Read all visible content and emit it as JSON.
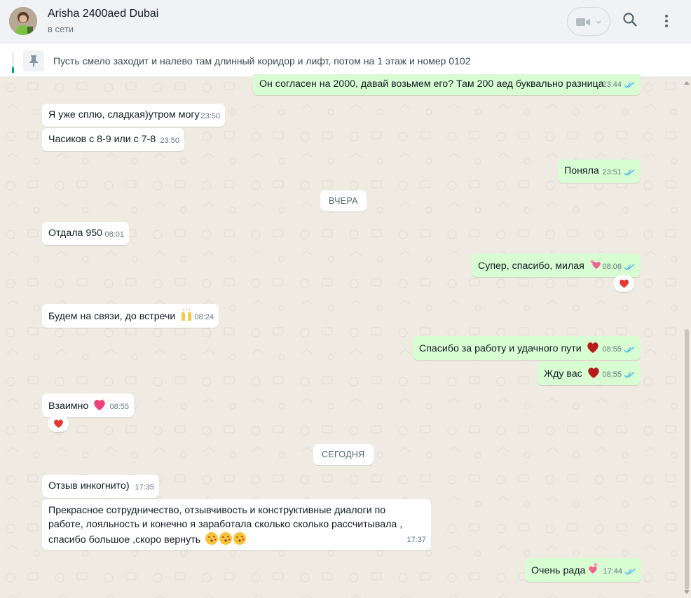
{
  "header": {
    "name": "Arisha 2400aed Dubai",
    "status": "в сети"
  },
  "pinned": {
    "text": "Пусть смело заходит и налево там длинный коридор и лифт, потом на 1 этаж и номер 0102"
  },
  "messages": [
    {
      "dir": "out",
      "text": "Он согласен на 2000, давай возьмем его? Там 200 аед буквально разница",
      "time": "23:44",
      "read": true
    },
    {
      "dir": "in",
      "text": "Я уже сплю, сладкая)утром могу",
      "time": "23:50"
    },
    {
      "dir": "in",
      "text": "Часиков с 8-9 или с 7-8",
      "time": "23:50"
    },
    {
      "dir": "out",
      "text": "Поняла",
      "time": "23:51",
      "read": true
    },
    {
      "dir": "divider",
      "text": "ВЧЕРА"
    },
    {
      "dir": "in",
      "text": "Отдала 950",
      "time": "08:01"
    },
    {
      "dir": "out",
      "text": "Супер, спасибо, милая",
      "emoji": "two-hearts",
      "time": "08:06",
      "read": true,
      "reaction": "heart"
    },
    {
      "dir": "in",
      "text": "Будем на связи, до встречи",
      "emoji": "raised-hands",
      "time": "08:24"
    },
    {
      "dir": "out",
      "text": "Спасибо за работу и удачного пути",
      "emoji": "heart",
      "time": "08:55",
      "read": true
    },
    {
      "dir": "out",
      "text": "Жду вас",
      "emoji": "heart",
      "time": "08:55",
      "read": true
    },
    {
      "dir": "in",
      "text": "Взаимно",
      "emoji": "sparkling-heart",
      "time": "08:55",
      "reaction": "heart"
    },
    {
      "dir": "divider",
      "text": "СЕГОДНЯ"
    },
    {
      "dir": "in",
      "text": "Отзыв инкогнито)",
      "time": "17:35"
    },
    {
      "dir": "in",
      "text": "Прекрасное сотрудничество, отзывчивость и конструктивные диалоги по работе, лояльность и конечно я заработала сколько сколько рассчитывала , спасибо большое ,скоро вернуть",
      "emoji": "kissing-face x3",
      "time": "17:37"
    },
    {
      "dir": "out",
      "text": "Очень рада",
      "emoji": "two-hearts",
      "time": "17:44",
      "read": true
    }
  ],
  "colors": {
    "incoming": "#ffffff",
    "outgoing": "#d9fdd3",
    "read_ticks": "#53bdeb",
    "background": "#efeae2",
    "accent": "#00a884"
  },
  "icons": [
    "video-camera-icon",
    "search-icon",
    "menu-dots-icon",
    "pin-icon",
    "double-check-icon",
    "heart-emoji"
  ]
}
